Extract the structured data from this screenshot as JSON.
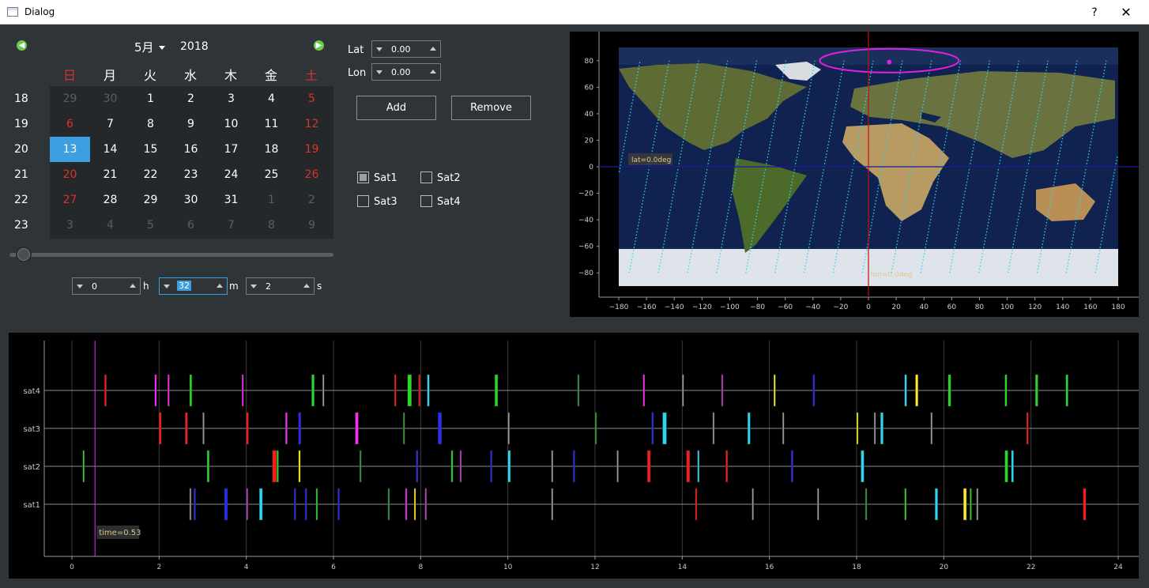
{
  "window": {
    "title": "Dialog",
    "help": "?",
    "close": "✕"
  },
  "calendar": {
    "month": "5月",
    "year": "2018",
    "weekdays": [
      "日",
      "月",
      "火",
      "水",
      "木",
      "金",
      "土"
    ],
    "weeks": [
      {
        "num": "18",
        "days": [
          "29",
          "30",
          "1",
          "2",
          "3",
          "4",
          "5"
        ]
      },
      {
        "num": "19",
        "days": [
          "6",
          "7",
          "8",
          "9",
          "10",
          "11",
          "12"
        ]
      },
      {
        "num": "20",
        "days": [
          "13",
          "14",
          "15",
          "16",
          "17",
          "18",
          "19"
        ]
      },
      {
        "num": "21",
        "days": [
          "20",
          "21",
          "22",
          "23",
          "24",
          "25",
          "26"
        ]
      },
      {
        "num": "22",
        "days": [
          "27",
          "28",
          "29",
          "30",
          "31",
          "1",
          "2"
        ]
      },
      {
        "num": "23",
        "days": [
          "3",
          "4",
          "5",
          "6",
          "7",
          "8",
          "9"
        ]
      }
    ],
    "selected": "13",
    "colors": {
      "weekend": "#e0312a",
      "selected_bg": "#3d9ee0",
      "nav_arrow": "#6cc94b"
    }
  },
  "slider": {
    "value_fraction": 0.02
  },
  "time": {
    "h": "0",
    "h_unit": "h",
    "m": "32",
    "m_unit": "m",
    "s": "2",
    "s_unit": "s"
  },
  "coords": {
    "lat_label": "Lat",
    "lat": "0.00",
    "lon_label": "Lon",
    "lon": "0.00"
  },
  "buttons": {
    "add": "Add",
    "remove": "Remove"
  },
  "satellites": [
    {
      "label": "Sat1",
      "checked": true
    },
    {
      "label": "Sat2",
      "checked": false
    },
    {
      "label": "Sat3",
      "checked": false
    },
    {
      "label": "Sat4",
      "checked": false
    }
  ],
  "map": {
    "y_ticks": [
      "80",
      "60",
      "40",
      "20",
      "0",
      "−20",
      "−40",
      "−60",
      "−80"
    ],
    "x_ticks": [
      "−180",
      "−160",
      "−140",
      "−120",
      "−100",
      "−80",
      "−60",
      "−40",
      "−20",
      "0",
      "20",
      "40",
      "60",
      "80",
      "100",
      "120",
      "140",
      "160",
      "180"
    ],
    "lat_annotation": "lat=0.0deg",
    "lon_annotation": "lon=0.0deg",
    "colors": {
      "orbit": "#2ed6f0",
      "ring": "#e020e0",
      "hline": "#1a1aa0",
      "vline": "#c01010"
    }
  },
  "timeline": {
    "rows": [
      "sat4",
      "sat3",
      "sat2",
      "sat1"
    ],
    "x_ticks": [
      "0",
      "2",
      "4",
      "6",
      "8",
      "10",
      "12",
      "14",
      "16",
      "18",
      "20",
      "22",
      "24"
    ],
    "time_label": "time=0.53",
    "cursor_time": 0.53,
    "colors": {
      "cursor": "#cc22cc",
      "axis": "#9a9a9a"
    }
  }
}
